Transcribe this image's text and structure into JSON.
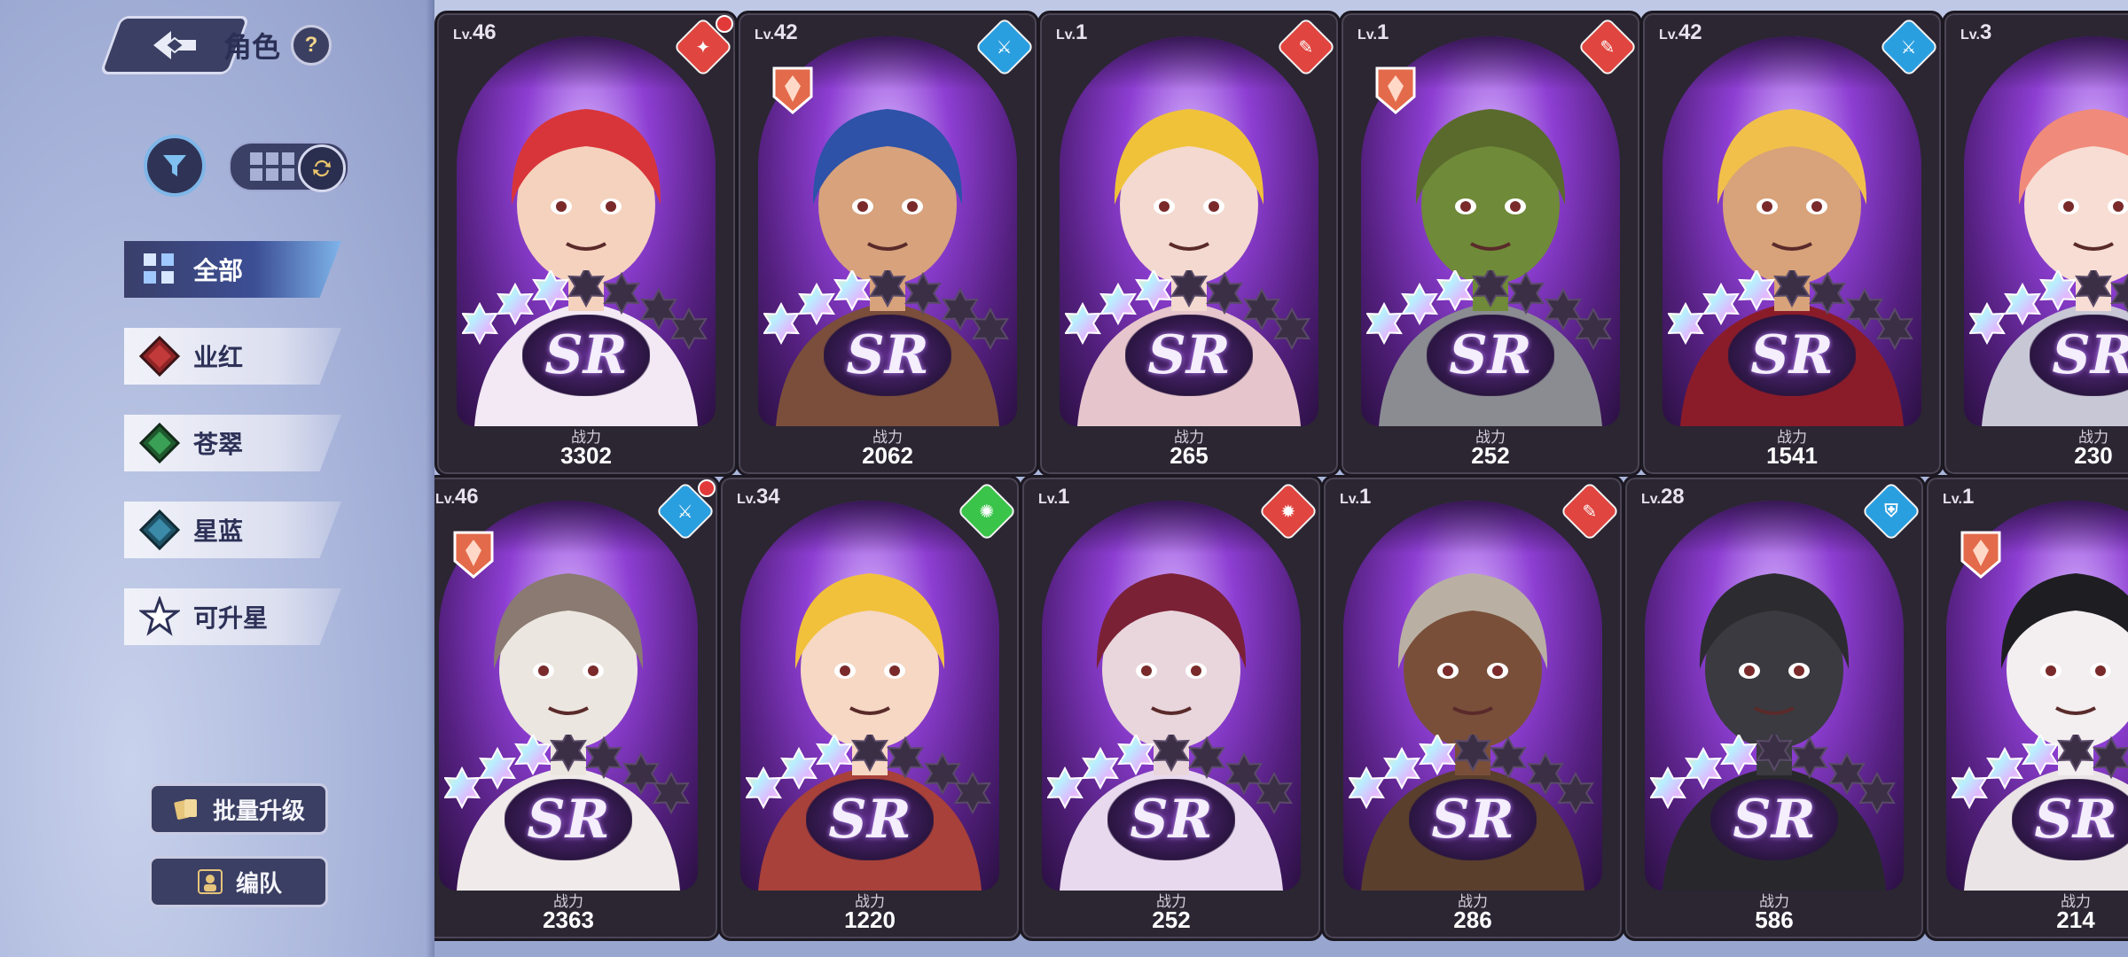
{
  "header": {
    "title": "角色",
    "help": "?"
  },
  "tabs": [
    {
      "label": "全部",
      "gem_color": "#6fa8f0"
    },
    {
      "label": "业红",
      "gem_color": "#c23a3a"
    },
    {
      "label": "苍翠",
      "gem_color": "#3aa055"
    },
    {
      "label": "星蓝",
      "gem_color": "#3a8aa8"
    },
    {
      "label": "可升星",
      "gem_color": "#ffffff"
    }
  ],
  "buttons": {
    "batch_upgrade": "批量升级",
    "formation": "编队"
  },
  "power_label": "战力",
  "rarity": "SR",
  "cards": [
    {
      "lv": "46",
      "power": "3302",
      "element_color": "#e0453f",
      "element_symbol": "✦",
      "badge_dot": true,
      "crest": false,
      "stars": 3
    },
    {
      "lv": "42",
      "power": "2062",
      "element_color": "#2a9fe0",
      "element_symbol": "⚔",
      "badge_dot": false,
      "crest": true,
      "stars": 3
    },
    {
      "lv": "1",
      "power": "265",
      "element_color": "#e0453f",
      "element_symbol": "✎",
      "badge_dot": false,
      "crest": false,
      "stars": 3
    },
    {
      "lv": "1",
      "power": "252",
      "element_color": "#e0453f",
      "element_symbol": "✎",
      "badge_dot": false,
      "crest": true,
      "stars": 3
    },
    {
      "lv": "42",
      "power": "1541",
      "element_color": "#2a9fe0",
      "element_symbol": "⚔",
      "badge_dot": false,
      "crest": false,
      "stars": 3
    },
    {
      "lv": "3",
      "power": "230",
      "element_color": "#e0453f",
      "element_symbol": "✎",
      "badge_dot": false,
      "crest": false,
      "stars": 3
    },
    {
      "lv": "46",
      "power": "2363",
      "element_color": "#2a9fe0",
      "element_symbol": "⚔",
      "badge_dot": true,
      "crest": true,
      "stars": 3
    },
    {
      "lv": "34",
      "power": "1220",
      "element_color": "#3ac44a",
      "element_symbol": "✺",
      "badge_dot": false,
      "crest": false,
      "stars": 3
    },
    {
      "lv": "1",
      "power": "252",
      "element_color": "#e0453f",
      "element_symbol": "✹",
      "badge_dot": false,
      "crest": false,
      "stars": 3
    },
    {
      "lv": "1",
      "power": "286",
      "element_color": "#e0453f",
      "element_symbol": "✎",
      "badge_dot": false,
      "crest": false,
      "stars": 3
    },
    {
      "lv": "28",
      "power": "586",
      "element_color": "#2a9fe0",
      "element_symbol": "⛨",
      "badge_dot": false,
      "crest": false,
      "stars": 3
    },
    {
      "lv": "1",
      "power": "214",
      "element_color": "#e0453f",
      "element_symbol": "✎",
      "badge_dot": false,
      "crest": true,
      "stars": 3
    }
  ],
  "art": [
    {
      "hair": "#d8353a",
      "skin": "#f5d2be",
      "cloth": "#f2e9f5"
    },
    {
      "hair": "#2d52a8",
      "skin": "#d7a27c",
      "cloth": "#7a4e3b"
    },
    {
      "hair": "#f0c23a",
      "skin": "#f3d9cf",
      "cloth": "#e6c6cc"
    },
    {
      "hair": "#5a6a2c",
      "skin": "#6f8a38",
      "cloth": "#8b8c92"
    },
    {
      "hair": "#f1c04b",
      "skin": "#d8a27a",
      "cloth": "#8a1c2a"
    },
    {
      "hair": "#f08a7a",
      "skin": "#f7ddd3",
      "cloth": "#c8c7d6"
    },
    {
      "hair": "#8a7a72",
      "skin": "#ece6e0",
      "cloth": "#f0eaea"
    },
    {
      "hair": "#f2c13c",
      "skin": "#f6d8c4",
      "cloth": "#a8413a"
    },
    {
      "hair": "#7a2136",
      "skin": "#e9d6dc",
      "cloth": "#e8d9ee"
    },
    {
      "hair": "#b9b0a3",
      "skin": "#7a4f3a",
      "cloth": "#5a3f2d"
    },
    {
      "hair": "#2c2c30",
      "skin": "#3a3a40",
      "cloth": "#28282c"
    },
    {
      "hair": "#1e1e22",
      "skin": "#f3eef0",
      "cloth": "#ebe4e6"
    }
  ]
}
